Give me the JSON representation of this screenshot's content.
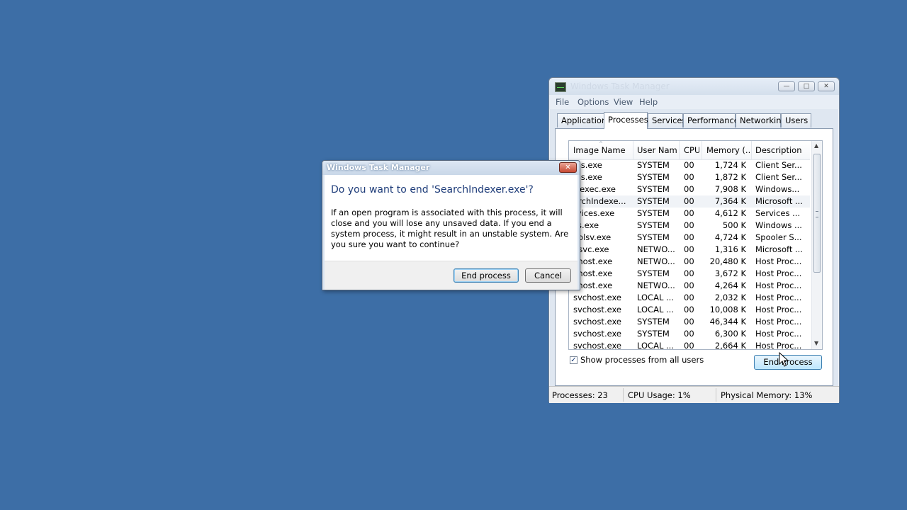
{
  "main_window": {
    "title": "Windows Task Manager",
    "caption_buttons": {
      "minimize": "—",
      "maximize": "□",
      "close": "✕"
    },
    "menu": [
      "File",
      "Options",
      "View",
      "Help"
    ],
    "tabs": [
      "Applications",
      "Processes",
      "Services",
      "Performance",
      "Networking",
      "Users"
    ],
    "active_tab": "Processes",
    "columns": [
      "Image Name",
      "User Name",
      "CPU",
      "Memory (...",
      "Description"
    ],
    "sort_indicator": "^",
    "rows": [
      {
        "name": "rss.exe",
        "user": "SYSTEM",
        "cpu": "00",
        "memory": "1,724 K",
        "description": "Client Ser..."
      },
      {
        "name": "rss.exe",
        "user": "SYSTEM",
        "cpu": "00",
        "memory": "1,872 K",
        "description": "Client Ser..."
      },
      {
        "name": "siexec.exe",
        "user": "SYSTEM",
        "cpu": "00",
        "memory": "7,908 K",
        "description": "Windows..."
      },
      {
        "name": "archIndexe...",
        "user": "SYSTEM",
        "cpu": "00",
        "memory": "7,364 K",
        "description": "Microsoft ..."
      },
      {
        "name": "rvices.exe",
        "user": "SYSTEM",
        "cpu": "00",
        "memory": "4,612 K",
        "description": "Services ..."
      },
      {
        "name": "ss.exe",
        "user": "SYSTEM",
        "cpu": "00",
        "memory": "500 K",
        "description": "Windows ..."
      },
      {
        "name": "oolsv.exe",
        "user": "SYSTEM",
        "cpu": "00",
        "memory": "4,724 K",
        "description": "Spooler S..."
      },
      {
        "name": "psvc.exe",
        "user": "NETWO...",
        "cpu": "00",
        "memory": "1,316 K",
        "description": "Microsoft ..."
      },
      {
        "name": "chost.exe",
        "user": "NETWO...",
        "cpu": "00",
        "memory": "20,480 K",
        "description": "Host Proc..."
      },
      {
        "name": "chost.exe",
        "user": "SYSTEM",
        "cpu": "00",
        "memory": "3,672 K",
        "description": "Host Proc..."
      },
      {
        "name": "chost.exe",
        "user": "NETWO...",
        "cpu": "00",
        "memory": "4,264 K",
        "description": "Host Proc..."
      },
      {
        "name": "svchost.exe",
        "user": "LOCAL ...",
        "cpu": "00",
        "memory": "2,032 K",
        "description": "Host Proc..."
      },
      {
        "name": "svchost.exe",
        "user": "LOCAL ...",
        "cpu": "00",
        "memory": "10,008 K",
        "description": "Host Proc..."
      },
      {
        "name": "svchost.exe",
        "user": "SYSTEM",
        "cpu": "00",
        "memory": "46,344 K",
        "description": "Host Proc..."
      },
      {
        "name": "svchost.exe",
        "user": "SYSTEM",
        "cpu": "00",
        "memory": "6,300 K",
        "description": "Host Proc..."
      },
      {
        "name": "svchost.exe",
        "user": "LOCAL ...",
        "cpu": "00",
        "memory": "2,664 K",
        "description": "Host Proc..."
      }
    ],
    "selected_row": 3,
    "show_all_label": "Show processes from all users",
    "show_all_checked": true,
    "end_process_label": "End Process",
    "status": {
      "processes": "Processes: 23",
      "cpu": "CPU Usage: 1%",
      "memory": "Physical Memory: 13%"
    }
  },
  "dialog": {
    "title": "Windows Task Manager",
    "close_glyph": "✕",
    "heading": "Do you want to end 'SearchIndexer.exe'?",
    "message": "If an open program is associated with this process, it will close and you will lose any unsaved data. If you end a system process, it might result in an unstable system. Are you sure you want to continue?",
    "confirm_label": "End process",
    "cancel_label": "Cancel"
  }
}
